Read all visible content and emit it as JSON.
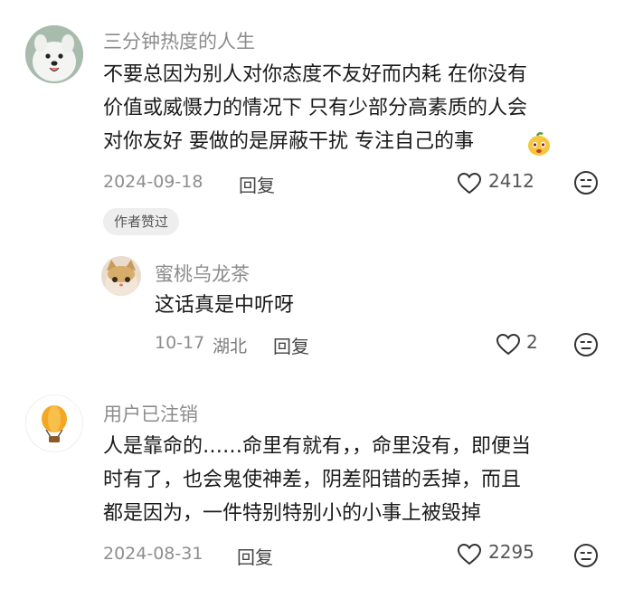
{
  "comments": [
    {
      "username": "三分钟热度的人生",
      "lines": [
        "不要总因为别人对你态度不友好而内耗 在你没有",
        "价值或威慑力的情况下 只有少部分高素质的人会",
        "对你友好 要做的是屏蔽干扰 专注自己的事"
      ],
      "date": "2024-09-18",
      "reply_label": "回复",
      "likes": "2412",
      "badge": "作者赞过",
      "avatar_icon": "dog-avatar-icon"
    },
    {
      "username": "蜜桃乌龙茶",
      "lines": [
        "这话真是中听呀"
      ],
      "date": "10-17",
      "location": "湖北",
      "reply_label": "回复",
      "likes": "2",
      "avatar_icon": "cat-avatar-icon"
    },
    {
      "username": "用户已注销",
      "lines": [
        "人是靠命的……命里有就有，，命里没有，即便当",
        "时有了，也会鬼使神差，阴差阳错的丢掉，而且",
        "都是因为，一件特别特别小的小事上被毁掉"
      ],
      "date": "2024-08-31",
      "reply_label": "回复",
      "likes": "2295",
      "avatar_icon": "balloon-avatar-icon"
    }
  ],
  "colors": {
    "username": "#8c8c8c",
    "text": "#1a1a1a",
    "meta": "#8e8e8e",
    "badge_bg": "#eeeeee"
  }
}
